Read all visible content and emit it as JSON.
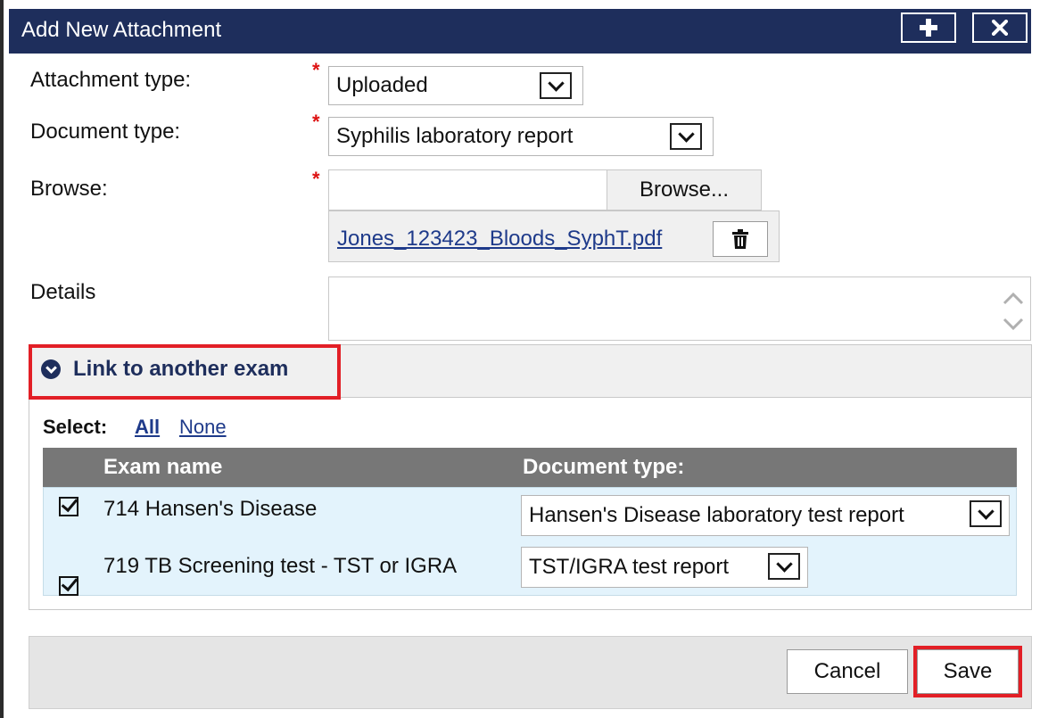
{
  "dialog": {
    "title": "Add New Attachment",
    "add_icon": "plus-icon",
    "close_icon": "close-icon"
  },
  "form": {
    "attachment_type": {
      "label": "Attachment type:",
      "required_mark": "*",
      "value": "Uploaded"
    },
    "document_type": {
      "label": "Document type:",
      "required_mark": "*",
      "value": "Syphilis laboratory report"
    },
    "browse": {
      "label": "Browse:",
      "required_mark": "*",
      "button_label": "Browse...",
      "file_name": "Jones_123423_Bloods_SyphT.pdf",
      "delete_icon": "trash-icon"
    },
    "details": {
      "label": "Details",
      "value": ""
    }
  },
  "link_section": {
    "header": "Link to another exam",
    "icon": "chevron-circle-down-icon",
    "select_label": "Select:",
    "select_all": "All",
    "select_none": "None",
    "columns": [
      "Exam name",
      "Document type:"
    ],
    "rows": [
      {
        "checked": true,
        "exam_name": "714 Hansen's Disease",
        "document_type": "Hansen's Disease laboratory test report"
      },
      {
        "checked": true,
        "exam_name": "719 TB Screening test - TST or IGRA",
        "document_type": "TST/IGRA test report"
      }
    ]
  },
  "footer": {
    "cancel_label": "Cancel",
    "save_label": "Save"
  },
  "colors": {
    "titlebar": "#1e2e5c",
    "table_header": "#777777",
    "table_body": "#e3f3fc",
    "highlight": "#e21f26",
    "link": "#1e3a8a",
    "required": "#dd1111"
  }
}
